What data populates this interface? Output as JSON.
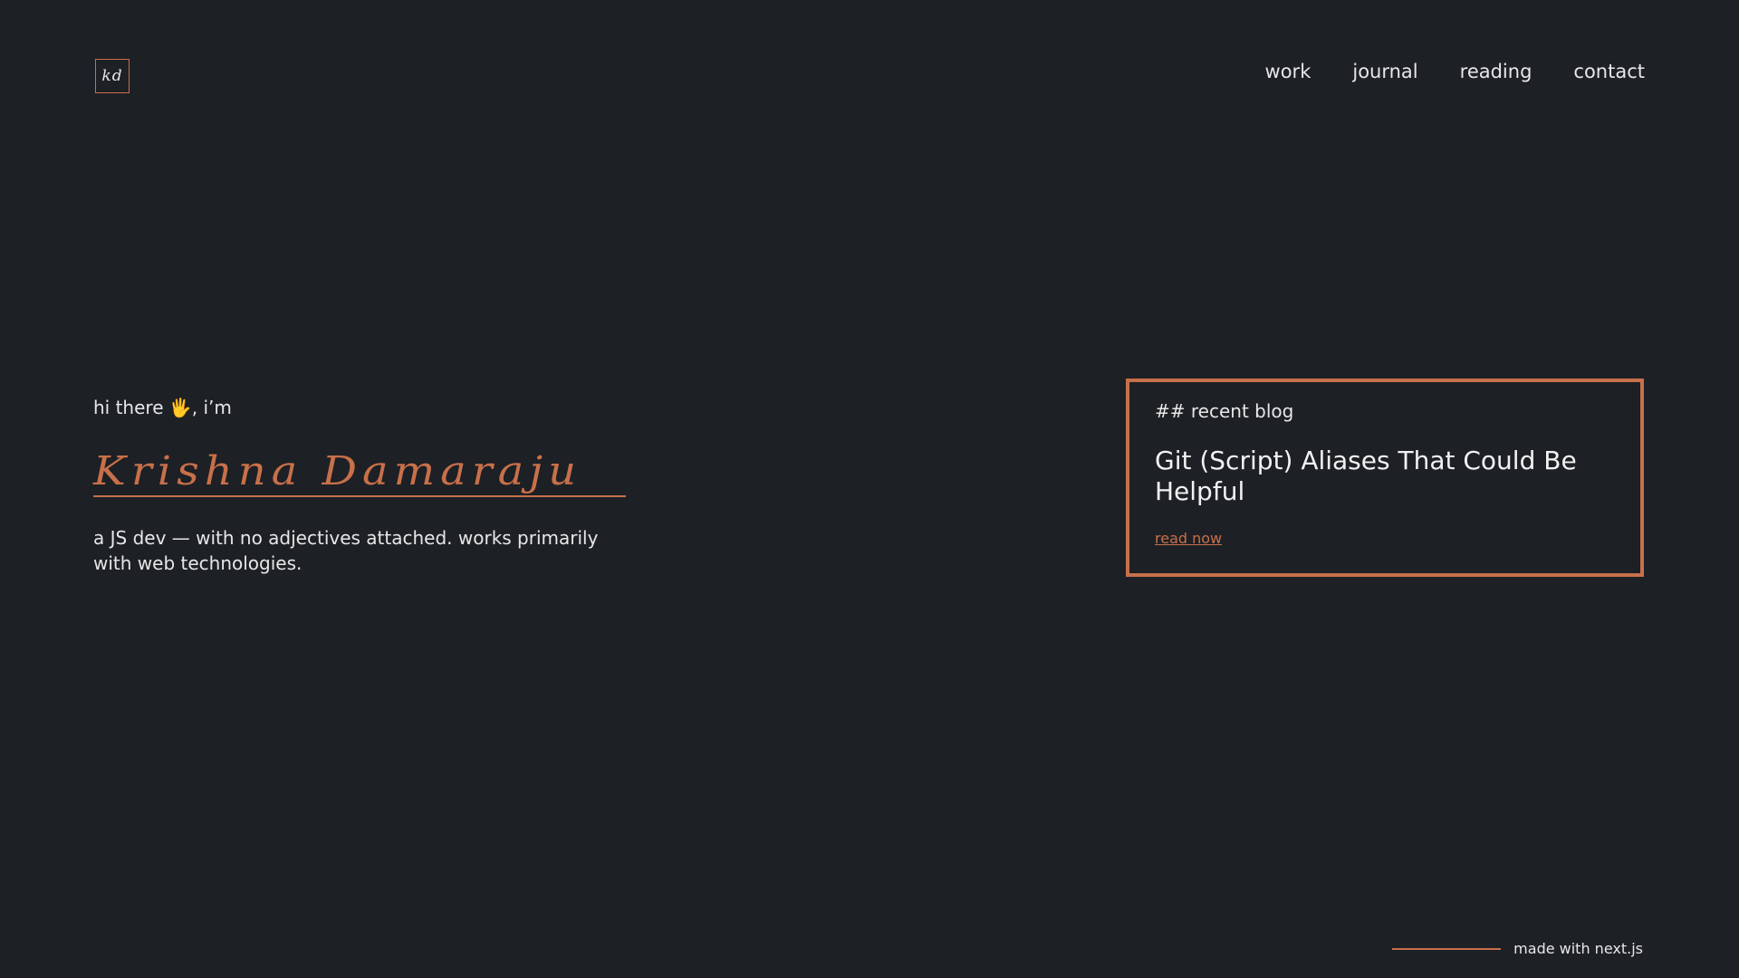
{
  "logo": {
    "text": "kd"
  },
  "nav": {
    "items": [
      {
        "label": "work"
      },
      {
        "label": "journal"
      },
      {
        "label": "reading"
      },
      {
        "label": "contact"
      }
    ]
  },
  "hero": {
    "greeting_prefix": "hi there ",
    "wave_emoji": "🖐",
    "greeting_suffix": ", i’m",
    "name": "Krishna Damaraju",
    "tagline": "a JS dev — with no adjectives attached. works primarily with web technologies."
  },
  "blog_card": {
    "kicker": "## recent blog",
    "title": "Git (Script) Aliases That Could Be Helpful",
    "link_label": "read now"
  },
  "footer": {
    "text": "made with next.js"
  },
  "colors": {
    "background": "#1d2025",
    "accent": "#c8704a",
    "text": "#e7e7e7"
  }
}
